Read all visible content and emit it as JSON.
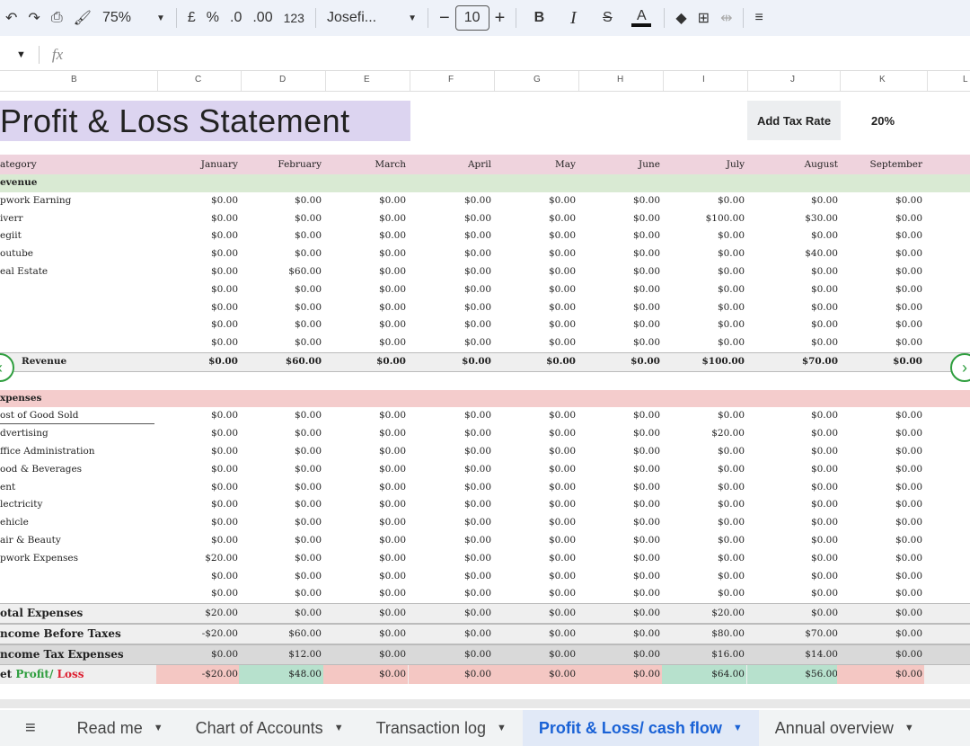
{
  "toolbar": {
    "zoom": "75%",
    "currency": "£",
    "percent": "%",
    "decrease_decimal": ".0",
    "increase_decimal": ".00",
    "number_format": "123",
    "font": "Josefi...",
    "font_size": "10",
    "minus": "−",
    "plus": "+",
    "bold": "B",
    "italic": "I",
    "strikethrough": "S",
    "text_color": "A"
  },
  "formula_bar": {
    "fx": "fx"
  },
  "columns": [
    "B",
    "C",
    "D",
    "E",
    "F",
    "G",
    "H",
    "I",
    "J",
    "K",
    "L"
  ],
  "title": "Profit & Loss Statement",
  "tax": {
    "button_label": "Add Tax Rate",
    "value": "20%"
  },
  "header": {
    "category": "ategory",
    "months": [
      "January",
      "February",
      "March",
      "April",
      "May",
      "June",
      "July",
      "August",
      "September"
    ]
  },
  "revenue": {
    "section_label": "evenue",
    "rows": [
      {
        "label": "pwork Earning",
        "values": [
          "$0.00",
          "$0.00",
          "$0.00",
          "$0.00",
          "$0.00",
          "$0.00",
          "$0.00",
          "$0.00",
          "$0.00"
        ]
      },
      {
        "label": "iverr",
        "values": [
          "$0.00",
          "$0.00",
          "$0.00",
          "$0.00",
          "$0.00",
          "$0.00",
          "$100.00",
          "$30.00",
          "$0.00"
        ]
      },
      {
        "label": "egiit",
        "values": [
          "$0.00",
          "$0.00",
          "$0.00",
          "$0.00",
          "$0.00",
          "$0.00",
          "$0.00",
          "$0.00",
          "$0.00"
        ]
      },
      {
        "label": "outube",
        "values": [
          "$0.00",
          "$0.00",
          "$0.00",
          "$0.00",
          "$0.00",
          "$0.00",
          "$0.00",
          "$40.00",
          "$0.00"
        ]
      },
      {
        "label": "eal Estate",
        "values": [
          "$0.00",
          "$60.00",
          "$0.00",
          "$0.00",
          "$0.00",
          "$0.00",
          "$0.00",
          "$0.00",
          "$0.00"
        ]
      },
      {
        "label": "",
        "values": [
          "$0.00",
          "$0.00",
          "$0.00",
          "$0.00",
          "$0.00",
          "$0.00",
          "$0.00",
          "$0.00",
          "$0.00"
        ]
      },
      {
        "label": "",
        "values": [
          "$0.00",
          "$0.00",
          "$0.00",
          "$0.00",
          "$0.00",
          "$0.00",
          "$0.00",
          "$0.00",
          "$0.00"
        ]
      },
      {
        "label": "",
        "values": [
          "$0.00",
          "$0.00",
          "$0.00",
          "$0.00",
          "$0.00",
          "$0.00",
          "$0.00",
          "$0.00",
          "$0.00"
        ]
      },
      {
        "label": "",
        "values": [
          "$0.00",
          "$0.00",
          "$0.00",
          "$0.00",
          "$0.00",
          "$0.00",
          "$0.00",
          "$0.00",
          "$0.00"
        ]
      }
    ],
    "total": {
      "label": "Revenue",
      "values": [
        "$0.00",
        "$60.00",
        "$0.00",
        "$0.00",
        "$0.00",
        "$0.00",
        "$100.00",
        "$70.00",
        "$0.00"
      ]
    }
  },
  "expenses": {
    "section_label": "xpenses",
    "rows": [
      {
        "label": "ost of Good Sold",
        "values": [
          "$0.00",
          "$0.00",
          "$0.00",
          "$0.00",
          "$0.00",
          "$0.00",
          "$0.00",
          "$0.00",
          "$0.00"
        ]
      },
      {
        "label": "dvertising",
        "values": [
          "$0.00",
          "$0.00",
          "$0.00",
          "$0.00",
          "$0.00",
          "$0.00",
          "$20.00",
          "$0.00",
          "$0.00"
        ]
      },
      {
        "label": "ffice Administration",
        "values": [
          "$0.00",
          "$0.00",
          "$0.00",
          "$0.00",
          "$0.00",
          "$0.00",
          "$0.00",
          "$0.00",
          "$0.00"
        ]
      },
      {
        "label": "ood & Beverages",
        "values": [
          "$0.00",
          "$0.00",
          "$0.00",
          "$0.00",
          "$0.00",
          "$0.00",
          "$0.00",
          "$0.00",
          "$0.00"
        ]
      },
      {
        "label": "ent",
        "values": [
          "$0.00",
          "$0.00",
          "$0.00",
          "$0.00",
          "$0.00",
          "$0.00",
          "$0.00",
          "$0.00",
          "$0.00"
        ]
      },
      {
        "label": "lectricity",
        "values": [
          "$0.00",
          "$0.00",
          "$0.00",
          "$0.00",
          "$0.00",
          "$0.00",
          "$0.00",
          "$0.00",
          "$0.00"
        ]
      },
      {
        "label": "ehicle",
        "values": [
          "$0.00",
          "$0.00",
          "$0.00",
          "$0.00",
          "$0.00",
          "$0.00",
          "$0.00",
          "$0.00",
          "$0.00"
        ]
      },
      {
        "label": "air & Beauty",
        "values": [
          "$0.00",
          "$0.00",
          "$0.00",
          "$0.00",
          "$0.00",
          "$0.00",
          "$0.00",
          "$0.00",
          "$0.00"
        ]
      },
      {
        "label": "pwork Expenses",
        "values": [
          "$20.00",
          "$0.00",
          "$0.00",
          "$0.00",
          "$0.00",
          "$0.00",
          "$0.00",
          "$0.00",
          "$0.00"
        ]
      },
      {
        "label": "",
        "values": [
          "$0.00",
          "$0.00",
          "$0.00",
          "$0.00",
          "$0.00",
          "$0.00",
          "$0.00",
          "$0.00",
          "$0.00"
        ]
      },
      {
        "label": "",
        "values": [
          "$0.00",
          "$0.00",
          "$0.00",
          "$0.00",
          "$0.00",
          "$0.00",
          "$0.00",
          "$0.00",
          "$0.00"
        ]
      }
    ]
  },
  "totals": [
    {
      "label": "otal Expenses",
      "values": [
        "$20.00",
        "$0.00",
        "$0.00",
        "$0.00",
        "$0.00",
        "$0.00",
        "$20.00",
        "$0.00",
        "$0.00"
      ]
    },
    {
      "label": "ncome Before Taxes",
      "values": [
        "-$20.00",
        "$60.00",
        "$0.00",
        "$0.00",
        "$0.00",
        "$0.00",
        "$80.00",
        "$70.00",
        "$0.00"
      ]
    },
    {
      "label": "ncome Tax Expenses",
      "values": [
        "$0.00",
        "$12.00",
        "$0.00",
        "$0.00",
        "$0.00",
        "$0.00",
        "$16.00",
        "$14.00",
        "$0.00"
      ]
    }
  ],
  "net": {
    "label_prefix": "et ",
    "label_profit": "Profit/",
    "label_loss": " Loss",
    "values": [
      "-$20.00",
      "$48.00",
      "$0.00",
      "$0.00",
      "$0.00",
      "$0.00",
      "$64.00",
      "$56.00",
      "$0.00"
    ],
    "status": [
      "loss",
      "profit",
      "loss",
      "loss",
      "loss",
      "loss",
      "profit",
      "profit",
      "loss"
    ],
    "colors": {
      "profit": "#b7e1cd",
      "loss": "#f4c7c3"
    }
  },
  "tabs": [
    {
      "label": "Read me",
      "active": false
    },
    {
      "label": "Chart of Accounts",
      "active": false
    },
    {
      "label": "Transaction log",
      "active": false
    },
    {
      "label": "Profit & Loss/ cash flow",
      "active": true
    },
    {
      "label": "Annual overview",
      "active": false
    }
  ]
}
